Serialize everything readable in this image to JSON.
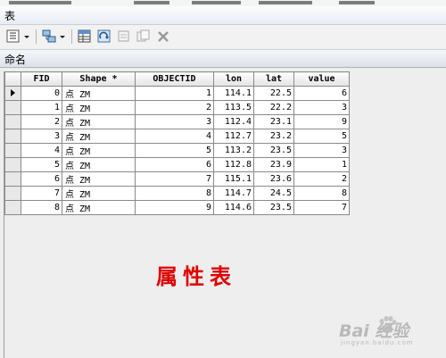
{
  "window": {
    "title": "表"
  },
  "toolbar": {
    "icons": [
      "table-options-icon",
      "related-tables-icon",
      "select-by-attributes-icon",
      "switch-selection-icon",
      "clear-selection-icon",
      "delete-selected-icon"
    ]
  },
  "table_caption": "命名",
  "grid": {
    "columns": [
      "FID",
      "Shape *",
      "OBJECTID",
      "lon",
      "lat",
      "value"
    ],
    "rows": [
      [
        "0",
        "点 ZM",
        "1",
        "114.1",
        "22.5",
        "6"
      ],
      [
        "1",
        "点 ZM",
        "2",
        "113.5",
        "22.2",
        "3"
      ],
      [
        "2",
        "点 ZM",
        "3",
        "112.4",
        "23.1",
        "9"
      ],
      [
        "3",
        "点 ZM",
        "4",
        "112.7",
        "23.2",
        "5"
      ],
      [
        "4",
        "点 ZM",
        "5",
        "113.2",
        "23.5",
        "3"
      ],
      [
        "5",
        "点 ZM",
        "6",
        "112.8",
        "23.9",
        "1"
      ],
      [
        "6",
        "点 ZM",
        "7",
        "115.1",
        "23.6",
        "2"
      ],
      [
        "7",
        "点 ZM",
        "8",
        "114.7",
        "24.5",
        "8"
      ],
      [
        "8",
        "点 ZM",
        "9",
        "114.6",
        "23.5",
        "7"
      ]
    ]
  },
  "annotation": "属性表",
  "watermark": {
    "text": "Bai 经验",
    "sub": "jingyan.baidu.com"
  },
  "colors": {
    "annotation": "#e00000",
    "watermark": "#b9b9b9"
  }
}
